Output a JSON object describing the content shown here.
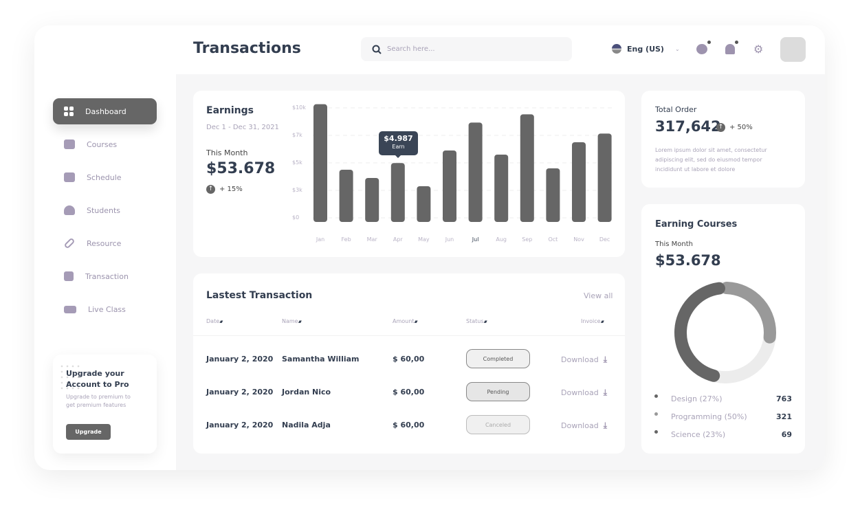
{
  "header": {
    "title": "Transactions",
    "search_placeholder": "Search here...",
    "language": "Eng (US)"
  },
  "sidebar": {
    "items": [
      {
        "label": "Dashboard",
        "icon": "grid-icon",
        "active": true
      },
      {
        "label": "Courses",
        "icon": "book-icon"
      },
      {
        "label": "Schedule",
        "icon": "calendar-icon"
      },
      {
        "label": "Students",
        "icon": "users-icon"
      },
      {
        "label": "Resource",
        "icon": "link-icon"
      },
      {
        "label": "Transaction",
        "icon": "swap-icon"
      },
      {
        "label": "Live Class",
        "icon": "video-icon"
      }
    ],
    "upgrade": {
      "title_line1": "Upgrade your",
      "title_line2": "Account to Pro",
      "desc_line1": "Upgrade to premium to",
      "desc_line2": "get premium features",
      "button": "Upgrade"
    }
  },
  "earnings": {
    "title": "Earnings",
    "range": "Dec 1 - Dec 31, 2021",
    "this_month_label": "This Month",
    "amount": "$53.678",
    "change": "+ 15%",
    "tooltip_value": "$4.987",
    "tooltip_label": "Earn"
  },
  "chart_data": {
    "type": "bar",
    "categories": [
      "Jan",
      "Feb",
      "Mar",
      "Apr",
      "May",
      "Jun",
      "Jul",
      "Aug",
      "Sep",
      "Oct",
      "Nov",
      "Dec"
    ],
    "values": [
      10400,
      4500,
      3900,
      4987,
      3300,
      5900,
      8400,
      5600,
      9300,
      4600,
      6500,
      7200
    ],
    "y_ticks": [
      {
        "v": 0,
        "label": "$0"
      },
      {
        "v": 3000,
        "label": "$3k"
      },
      {
        "v": 5000,
        "label": "$5k"
      },
      {
        "v": 7000,
        "label": "$7k"
      },
      {
        "v": 10000,
        "label": "$10k"
      }
    ],
    "highlight": "Apr",
    "grid": true,
    "bar_color": "#666666"
  },
  "total_order": {
    "label": "Total Order",
    "value": "317,642",
    "change": "+ 50%",
    "desc_line1": "Lorem ipsum dolor sit amet, consectetur",
    "desc_line2": "adipiscing elit, sed do eiusmod tempor",
    "desc_line3": "incididunt ut labore et dolore"
  },
  "earning_courses": {
    "title": "Earning Courses",
    "this_month_label": "This Month",
    "amount": "$53.678",
    "legend": [
      {
        "label": "Design (27%)",
        "value": "763",
        "color": "#666666"
      },
      {
        "label": "Programming (50%)",
        "value": "321",
        "color": "#999999"
      },
      {
        "label": "Science (23%)",
        "value": "69",
        "color": "#666666"
      }
    ]
  },
  "transactions": {
    "title": "Lastest Transaction",
    "view_all": "View all",
    "columns": [
      "Date",
      "Name",
      "Amount",
      "Status",
      "Invoice"
    ],
    "rows": [
      {
        "date": "January 2, 2020",
        "name": "Samantha William",
        "amount": "$ 60,00",
        "status": "Completed",
        "invoice": "Download"
      },
      {
        "date": "January 2, 2020",
        "name": "Jordan Nico",
        "amount": "$ 60,00",
        "status": "Pending",
        "invoice": "Download"
      },
      {
        "date": "January 2, 2020",
        "name": "Nadila Adja",
        "amount": "$ 60,00",
        "status": "Canceled",
        "invoice": "Download"
      }
    ]
  }
}
